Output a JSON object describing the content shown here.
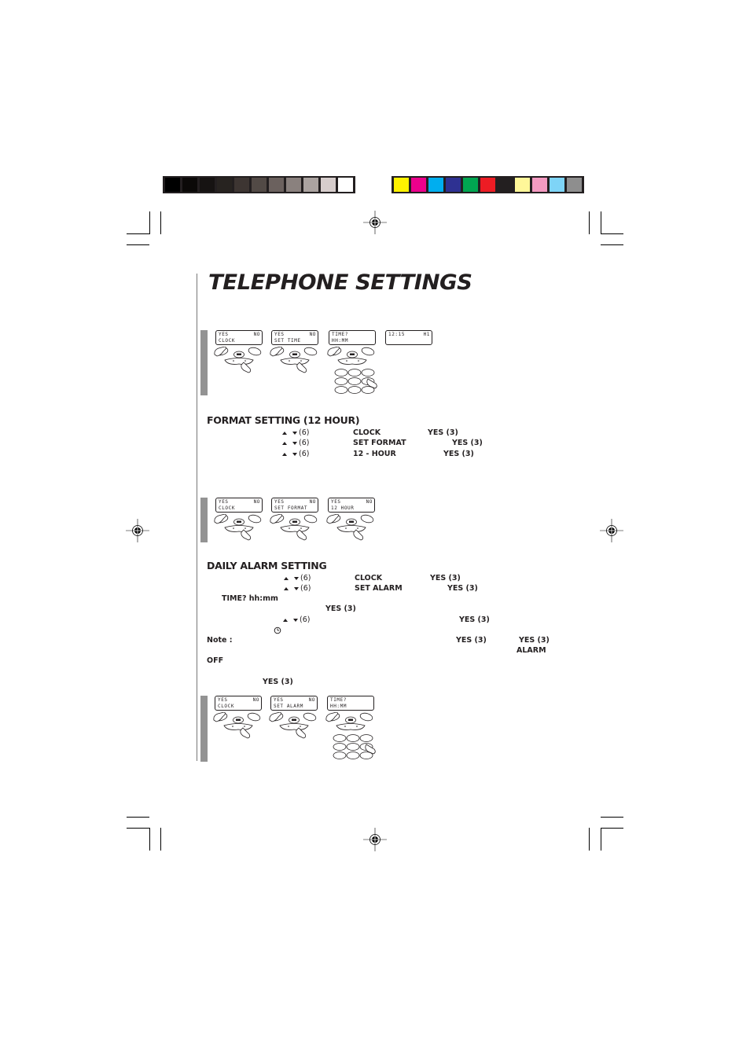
{
  "color_bars": {
    "grayscale": [
      "#000000",
      "#0b0908",
      "#161312",
      "#272320",
      "#3d3532",
      "#524a46",
      "#6b615e",
      "#8a817e",
      "#aba3a0",
      "#d6cdcc",
      "#ffffff"
    ],
    "process": [
      "#fff200",
      "#ec008c",
      "#00aeef",
      "#2e3192",
      "#00a651",
      "#ed1c24",
      "#231f20",
      "#fff799",
      "#f49ac1",
      "#7ed4f7",
      "#8e8e8e"
    ]
  },
  "page_title": "TELEPHONE SETTINGS",
  "figure1": {
    "screens": [
      {
        "line1_left": "YES",
        "line1_right": "NO",
        "line2": "CLOCK"
      },
      {
        "line1_left": "YES",
        "line1_right": "NO",
        "line2": "SET TIME"
      },
      {
        "line1_left": "TIME?",
        "line1_right": "",
        "line2": "HH:MM"
      },
      {
        "line1_left": "12:15",
        "line1_right": "H1",
        "line2": ""
      }
    ]
  },
  "format_section": {
    "heading": "FORMAT SETTING (12 HOUR)",
    "rows": [
      {
        "key": "(6)",
        "item": "CLOCK",
        "confirm": "YES (3)"
      },
      {
        "key": "(6)",
        "item": "SET FORMAT",
        "confirm": "YES (3)"
      },
      {
        "key": "(6)",
        "item": "12 - HOUR",
        "confirm": "YES (3)"
      }
    ]
  },
  "figure2": {
    "screens": [
      {
        "line1_left": "YES",
        "line1_right": "NO",
        "line2": "CLOCK"
      },
      {
        "line1_left": "YES",
        "line1_right": "NO",
        "line2": "SET FORMAT"
      },
      {
        "line1_left": "YES",
        "line1_right": "NO",
        "line2": "12 HOUR"
      }
    ]
  },
  "alarm_section": {
    "heading": "DAILY ALARM SETTING",
    "rows": [
      {
        "key": "(6)",
        "item": "CLOCK",
        "confirm": "YES (3)"
      },
      {
        "key": "(6)",
        "item": "SET ALARM",
        "confirm": "YES (3)"
      }
    ],
    "time_prompt": "TIME?  hh:mm",
    "confirm_after_time": "YES  (3)",
    "row4_key": "(6)",
    "row4_confirm": "YES  (3)",
    "note_label": "Note :",
    "note_yes1": "YES  (3)",
    "note_yes2": "YES  (3)",
    "note_alarm": "ALARM",
    "off_label": "OFF",
    "final_yes": "YES  (3)"
  },
  "figure3": {
    "screens": [
      {
        "line1_left": "YES",
        "line1_right": "NO",
        "line2": "CLOCK"
      },
      {
        "line1_left": "YES",
        "line1_right": "NO",
        "line2": "SET ALARM"
      },
      {
        "line1_left": "TIME?",
        "line1_right": "",
        "line2": "HH:MM"
      }
    ]
  }
}
